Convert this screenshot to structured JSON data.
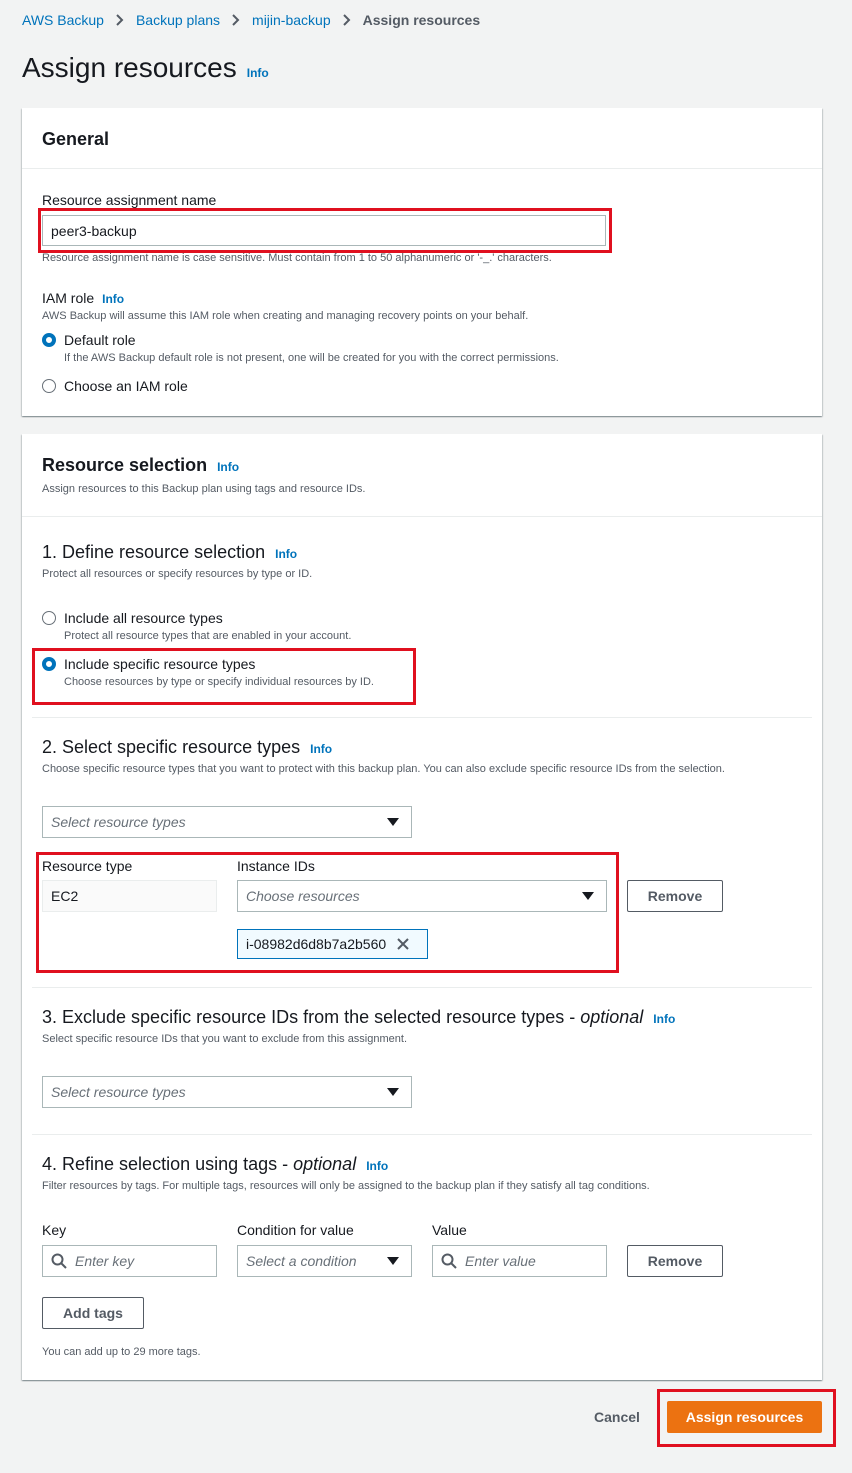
{
  "breadcrumb": {
    "items": [
      "AWS Backup",
      "Backup plans",
      "mijin-backup"
    ],
    "current": "Assign resources"
  },
  "page": {
    "title": "Assign resources",
    "info": "Info"
  },
  "general": {
    "heading": "General",
    "name_label": "Resource assignment name",
    "name_value": "peer3-backup",
    "name_hint": "Resource assignment name is case sensitive. Must contain from 1 to 50 alphanumeric or '-_.' characters.",
    "iam_label": "IAM role",
    "iam_info": "Info",
    "iam_desc": "AWS Backup will assume this IAM role when creating and managing recovery points on your behalf.",
    "default_role_label": "Default role",
    "default_role_desc": "If the AWS Backup default role is not present, one will be created for you with the correct permissions.",
    "choose_role_label": "Choose an IAM role"
  },
  "selection": {
    "heading": "Resource selection",
    "info": "Info",
    "desc": "Assign resources to this Backup plan using tags and resource IDs.",
    "step1": {
      "title": "1. Define resource selection",
      "info": "Info",
      "desc": "Protect all resources or specify resources by type or ID.",
      "opt_all_label": "Include all resource types",
      "opt_all_desc": "Protect all resource types that are enabled in your account.",
      "opt_specific_label": "Include specific resource types",
      "opt_specific_desc": "Choose resources by type or specify individual resources by ID."
    },
    "step2": {
      "title": "2. Select specific resource types",
      "info": "Info",
      "desc": "Choose specific resource types that you want to protect with this backup plan. You can also exclude specific resource IDs from the selection.",
      "select_placeholder": "Select resource types",
      "col_type": "Resource type",
      "col_ids": "Instance IDs",
      "type_value": "EC2",
      "ids_placeholder": "Choose resources",
      "remove_label": "Remove",
      "token": "i-08982d6d8b7a2b560"
    },
    "step3": {
      "title": "3. Exclude specific resource IDs from the selected resource types - ",
      "optional": "optional",
      "info": "Info",
      "desc": "Select specific resource IDs that you want to exclude from this assignment.",
      "select_placeholder": "Select resource types"
    },
    "step4": {
      "title": "4. Refine selection using tags - ",
      "optional": "optional",
      "info": "Info",
      "desc": "Filter resources by tags. For multiple tags, resources will only be assigned to the backup plan if they satisfy all tag conditions.",
      "key_label": "Key",
      "key_placeholder": "Enter key",
      "cond_label": "Condition for value",
      "cond_placeholder": "Select a condition",
      "value_label": "Value",
      "value_placeholder": "Enter value",
      "remove_label": "Remove",
      "add_tags_label": "Add tags",
      "limit_note": "You can add up to 29 more tags."
    }
  },
  "footer": {
    "cancel_label": "Cancel",
    "submit_label": "Assign resources"
  },
  "colors": {
    "accent": "#ec7211",
    "link": "#0073bb",
    "highlight": "#e0101f"
  }
}
